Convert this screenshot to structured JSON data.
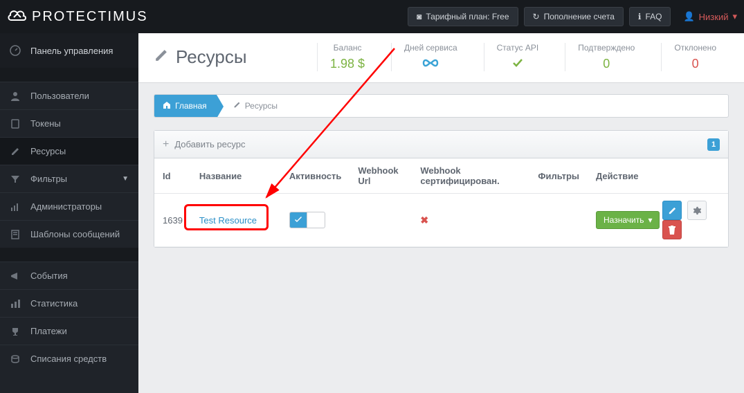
{
  "brand": "PROTECTIMUS",
  "topbar": {
    "plan": "Тарифный план: Free",
    "fund": "Пополнение счета",
    "faq": "FAQ",
    "user": "Низкий"
  },
  "sidebar": {
    "control": "Панель управления",
    "users": "Пользователи",
    "tokens": "Токены",
    "resources": "Ресурсы",
    "filters": "Фильтры",
    "admins": "Администраторы",
    "templates": "Шаблоны сообщений",
    "events": "События",
    "stats": "Статистика",
    "payments": "Платежи",
    "debits": "Списания средств"
  },
  "page": {
    "title": "Ресурсы"
  },
  "stats": {
    "balance_label": "Баланс",
    "balance_val": "1.98 $",
    "days_label": "Дней сервиса",
    "days_val": "∞",
    "api_label": "Статус API",
    "confirmed_label": "Подтверждено",
    "confirmed_val": "0",
    "rejected_label": "Отклонено",
    "rejected_val": "0"
  },
  "breadcrumb": {
    "home": "Главная",
    "current": "Ресурсы"
  },
  "panel": {
    "add": "Добавить ресурс",
    "count": "1"
  },
  "table": {
    "cols": {
      "id": "Id",
      "name": "Название",
      "activity": "Активность",
      "webhook": "Webhook Url",
      "cert": "Webhook сертифицирован.",
      "filters": "Фильтры",
      "action": "Действие"
    },
    "row": {
      "id": "1639",
      "name": "Test Resource",
      "assign": "Назначить"
    }
  }
}
